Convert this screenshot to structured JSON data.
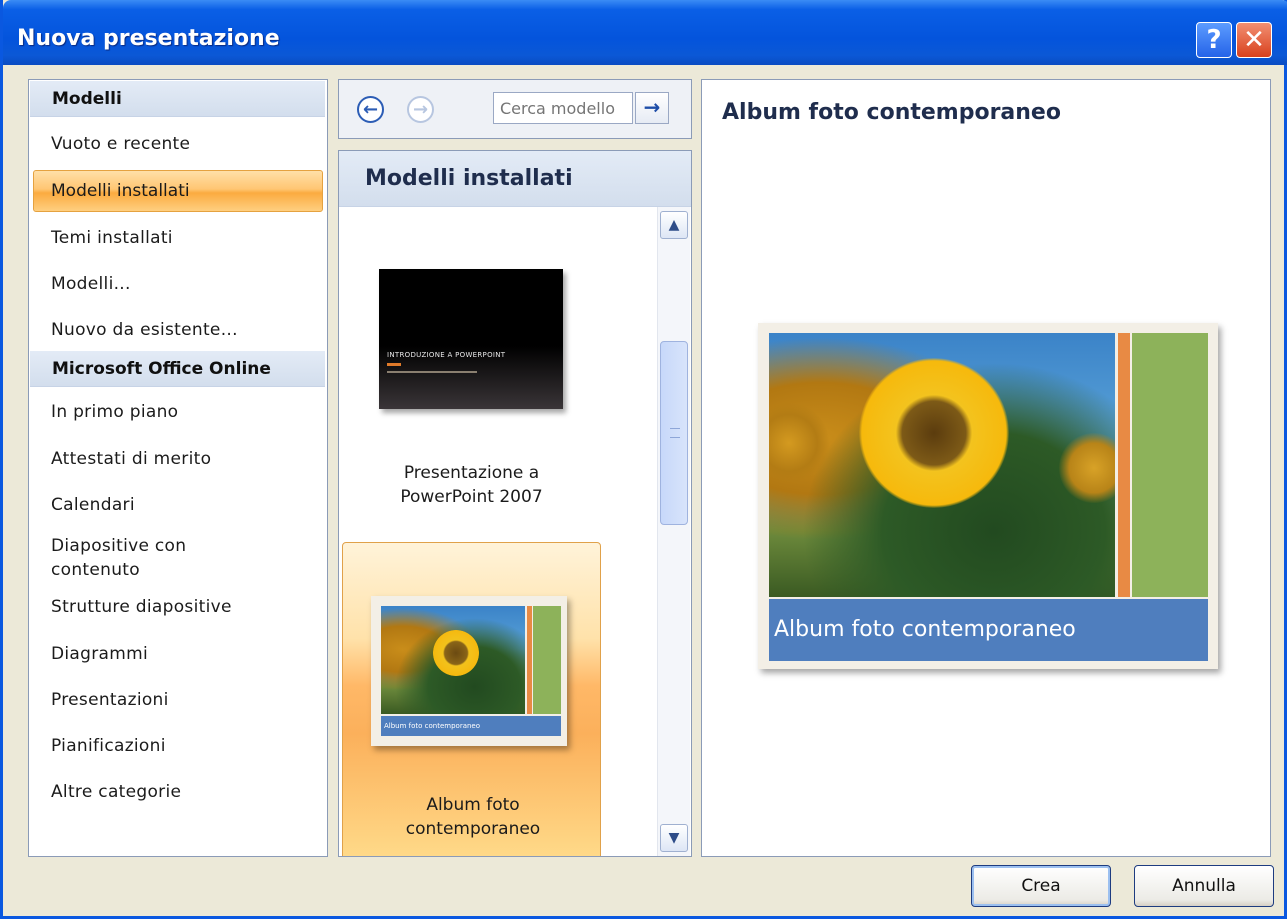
{
  "window": {
    "title": "Nuova presentazione",
    "help_button": "?",
    "close_button": "✕"
  },
  "sidebar": {
    "header_templates": "Modelli",
    "items_top": [
      {
        "label": "Vuoto e recente"
      },
      {
        "label": "Modelli installati",
        "selected": true
      },
      {
        "label": "Temi installati"
      },
      {
        "label": "Modelli..."
      },
      {
        "label": "Nuovo da esistente..."
      }
    ],
    "header_online": "Microsoft Office Online",
    "items_online": [
      {
        "label": "In primo piano"
      },
      {
        "label": "Attestati di merito"
      },
      {
        "label": "Calendari"
      },
      {
        "label": "Diapositive con contenuto"
      },
      {
        "label": "Strutture diapositive"
      },
      {
        "label": "Diagrammi"
      },
      {
        "label": "Presentazioni"
      },
      {
        "label": "Pianificazioni"
      },
      {
        "label": "Altre categorie"
      }
    ]
  },
  "search": {
    "placeholder": "Cerca modello",
    "back_icon": "arrow-left-icon",
    "forward_icon": "arrow-right-icon",
    "go_icon": "arrow-right-icon"
  },
  "gallery": {
    "header": "Modelli installati",
    "items": [
      {
        "label": "Presentazione a PowerPoint 2007",
        "thumb_title": "INTRODUZIONE A POWERPOINT"
      },
      {
        "label": "Album foto contemporaneo",
        "thumb_title": "Album foto contemporaneo",
        "selected": true
      }
    ]
  },
  "preview": {
    "title": "Album foto contemporaneo",
    "slide_caption": "Album foto contemporaneo"
  },
  "buttons": {
    "create": "Crea",
    "cancel": "Annulla"
  },
  "colors": {
    "titlebar": "#0454dc",
    "selection": "#fbab40",
    "slide_band": "#4f7ebe",
    "slide_green": "#8db25a",
    "slide_orange": "#e88a44"
  }
}
